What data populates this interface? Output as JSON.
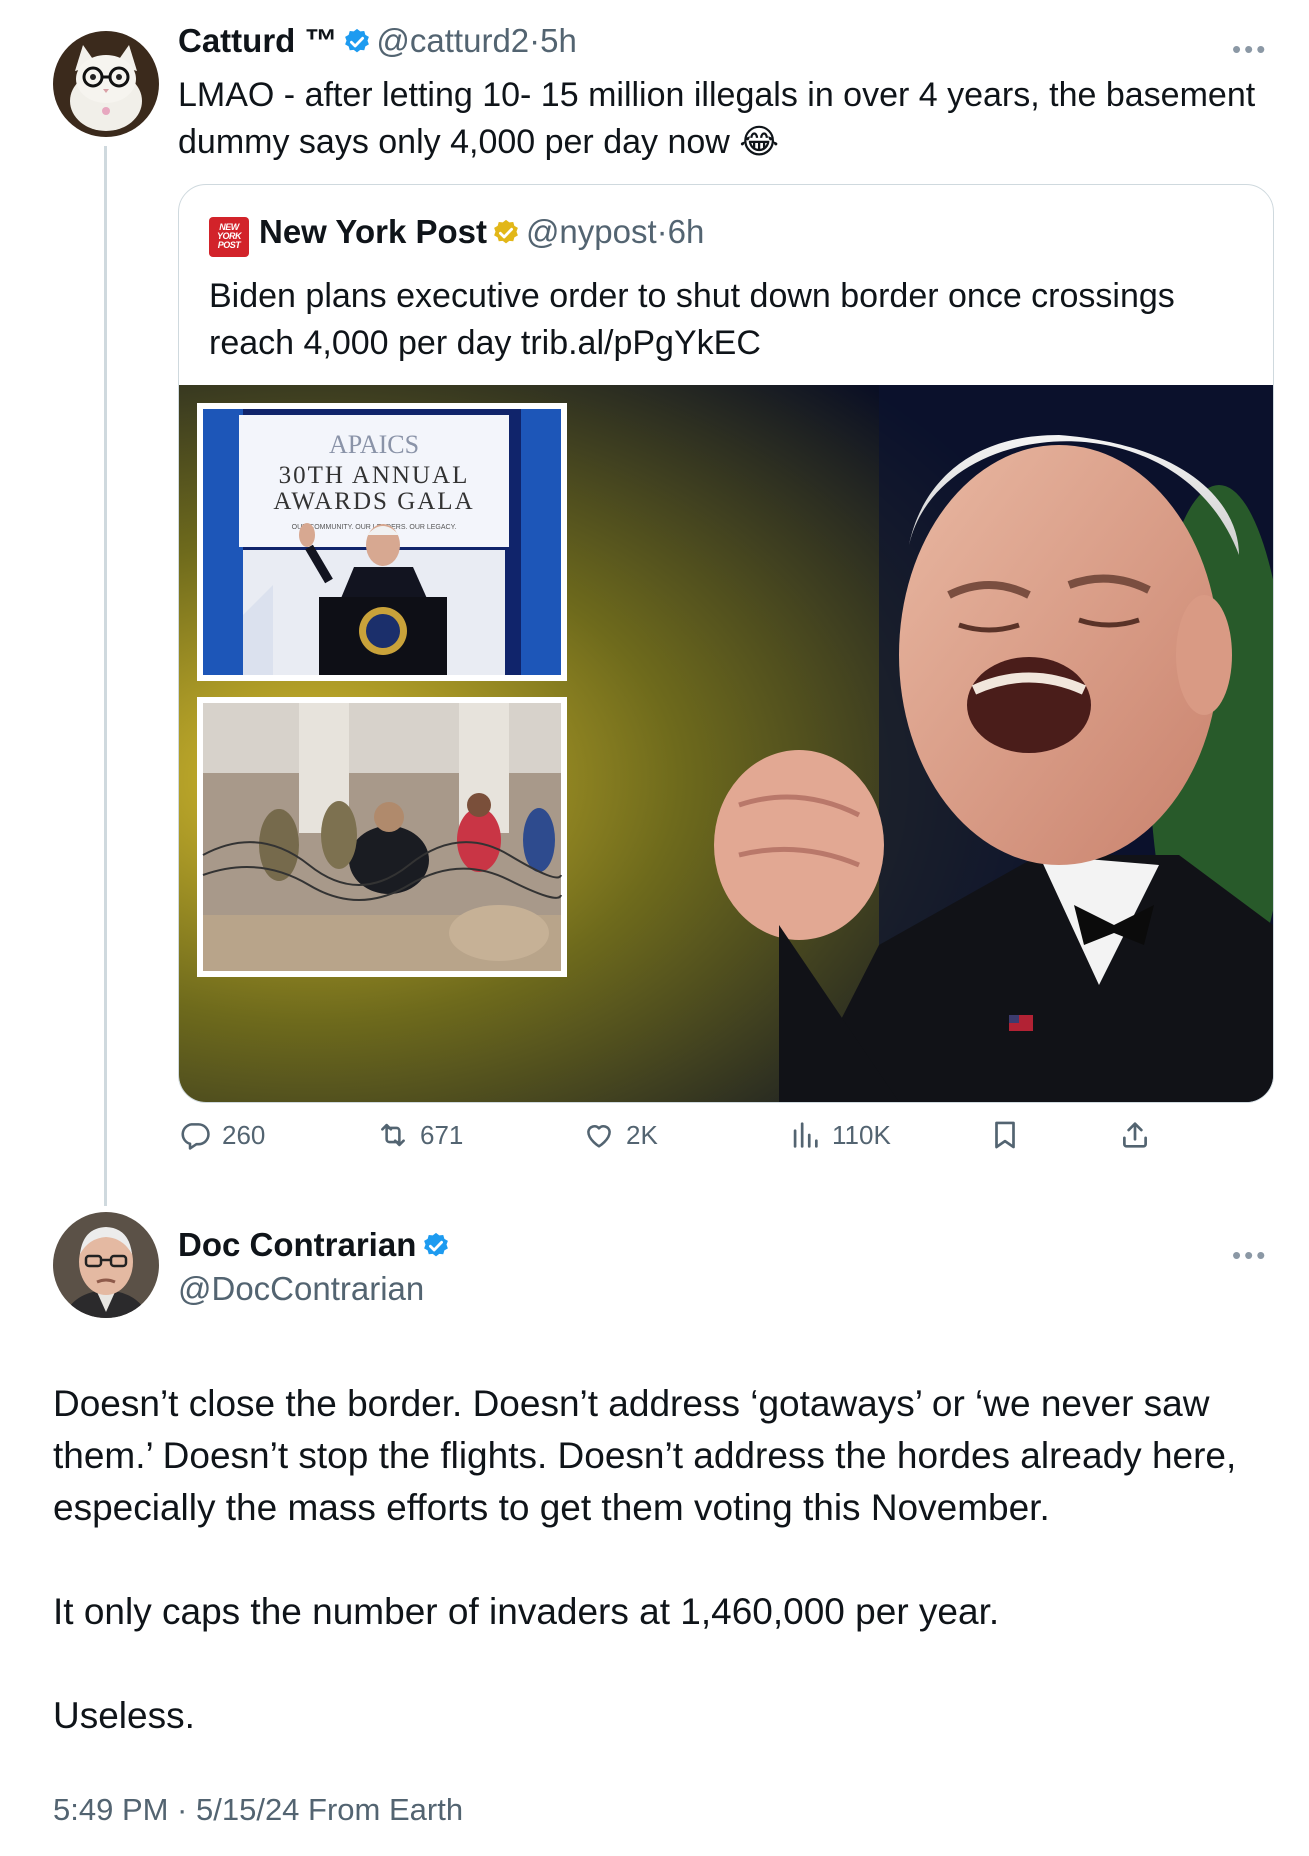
{
  "tweet": {
    "author_name": "Catturd ™",
    "handle": "@catturd2",
    "time": "5h",
    "separator": "·",
    "more": "•••",
    "text": "LMAO - after letting 10- 15 million illegals in over 4 years, the basement dummy says only 4,000 per day now",
    "emoji": "😂",
    "quoted": {
      "logo_text": "NEW YORK POST",
      "author_name": "New York Post",
      "handle": "@nypost",
      "time": "6h",
      "text": "Biden plans executive order to shut down border once crossings reach 4,000 per day trib.al/pPgYkEC",
      "image": {
        "inset_sign_line1": "APAICS",
        "inset_sign_line2": "30TH ANNUAL",
        "inset_sign_line3": "AWARDS GALA",
        "inset_sign_tagline": "OUR COMMUNITY. OUR LEADERS. OUR LEGACY."
      }
    },
    "actions": {
      "replies": "260",
      "reposts": "671",
      "likes": "2K",
      "views": "110K"
    }
  },
  "reply": {
    "author_name": "Doc Contrarian",
    "handle": "@DocContrarian",
    "more": "•••",
    "paragraph1": "Doesn’t close the border. Doesn’t address ‘gotaways’ or ‘we never saw them.’ Doesn’t stop the flights. Doesn’t address the hordes already here, especially the mass efforts to get them voting this November.",
    "paragraph2": "It only caps the number of invaders at 1,460,000 per year.",
    "paragraph3": "Useless.",
    "timestamp": "5:49 PM · 5/15/24 From Earth"
  },
  "colors": {
    "verified_blue": "#1d9bf0",
    "verified_gold": "#e2b719",
    "text_primary": "#0f1419",
    "text_secondary": "#536471",
    "border": "#cfd9de"
  }
}
